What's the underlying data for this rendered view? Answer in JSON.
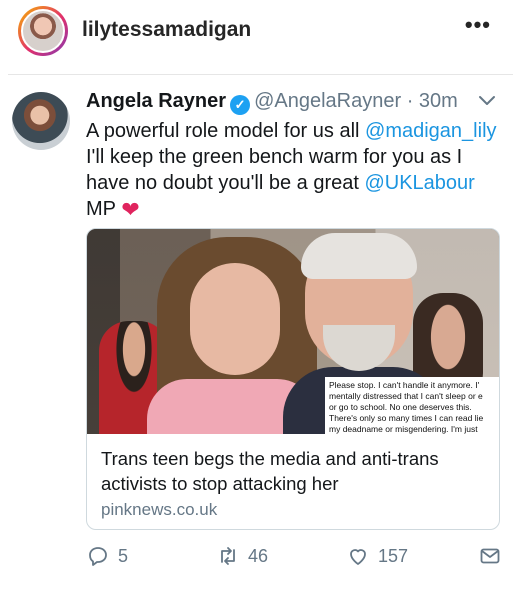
{
  "instagram": {
    "username": "lilytessamadigan",
    "more_icon": "more-horizontal-icon"
  },
  "tweet": {
    "author_name": "Angela Rayner",
    "verified_icon": "verified-check-icon",
    "handle": "@AngelaRayner",
    "separator": "·",
    "time": "30m",
    "chevron_icon": "chevron-down-icon",
    "text": {
      "part1": "A powerful role model for us all ",
      "mention1": "@madigan_lily",
      "part2": " I'll keep the green bench warm for you as I have no doubt you'll be a great ",
      "mention2": "@UKLabour",
      "part3": " MP ",
      "heart": "❤"
    },
    "card": {
      "image_caption": [
        "Please stop. I can't handle it anymore. I'",
        "mentally distressed that I can't sleep or e",
        "or go to school. No one deserves this.",
        "There's only so many times I can read lie",
        "my deadname or misgendering. I'm just"
      ],
      "title": "Trans teen begs the media and anti-trans activists to stop attacking her",
      "domain": "pinknews.co.uk"
    },
    "actions": {
      "reply_count": "5",
      "retweet_count": "46",
      "like_count": "157",
      "icons": [
        "reply-icon",
        "retweet-icon",
        "like-heart-icon",
        "direct-message-icon"
      ]
    },
    "colors": {
      "link": "#1b95e0",
      "verified": "#1da1f2",
      "heart": "#e0245e",
      "muted": "#657786"
    }
  }
}
